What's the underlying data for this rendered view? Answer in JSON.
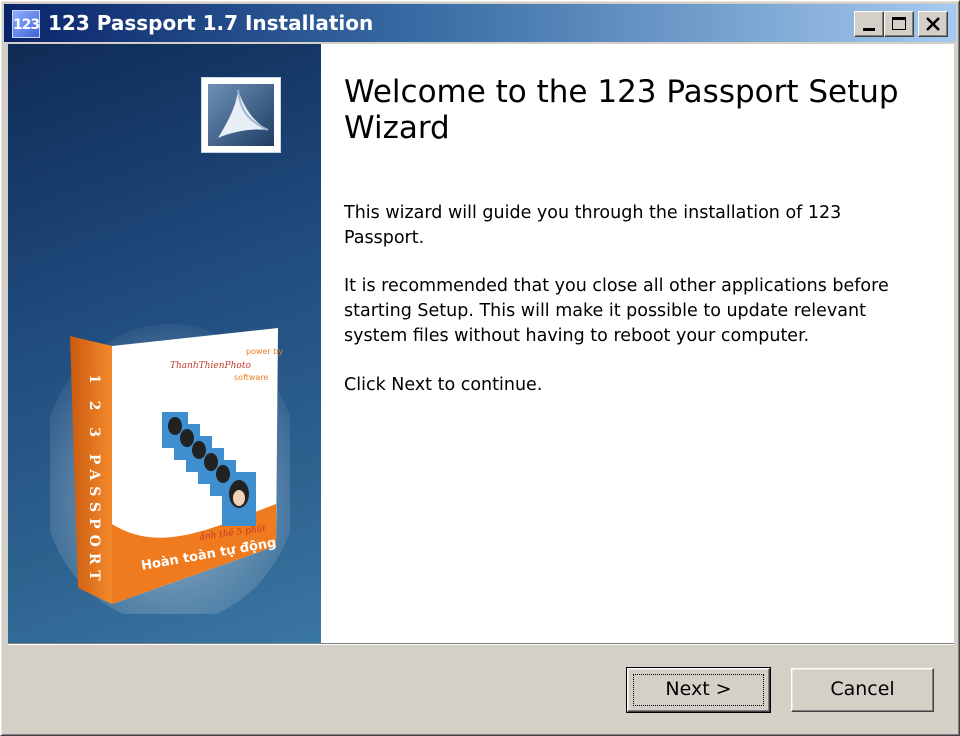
{
  "window": {
    "title": "123 Passport 1.7 Installation",
    "icon_text": "123",
    "icon": "app-icon"
  },
  "caption_buttons": {
    "minimize": "minimize-icon",
    "maximize": "maximize-icon",
    "close": "close-icon"
  },
  "side_panel": {
    "box_art": {
      "spine_text": "1 2 3 PASSPORT",
      "power_by": "power by",
      "brand": "ThanhThienPhoto",
      "software": "software",
      "tagline": "ảnh thẻ 5 phút",
      "slogan": "Hoàn toàn tự động"
    }
  },
  "main": {
    "heading": "Welcome to the 123 Passport Setup Wizard",
    "paragraphs": [
      "This wizard will guide you through the installation of 123 Passport.",
      "It is recommended that you close all other applications before starting Setup. This will make it possible to update relevant system files without having to reboot your computer.",
      "Click Next to continue."
    ]
  },
  "footer": {
    "next_label": "Next >",
    "cancel_label": "Cancel"
  },
  "colors": {
    "titlebar_start": "#0a246a",
    "titlebar_end": "#a6caf0",
    "side_panel": "#1f4a7d",
    "box_orange": "#f07b1e",
    "dialog_face": "#d4d0c8"
  }
}
